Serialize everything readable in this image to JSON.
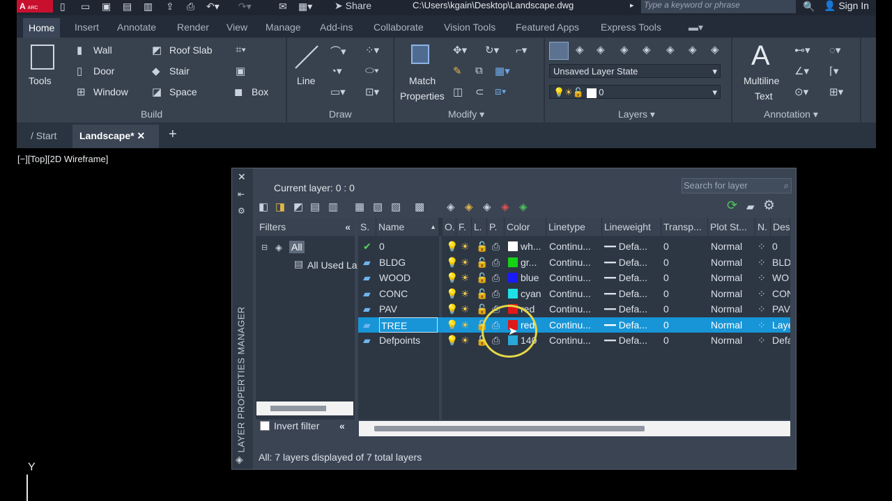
{
  "titlebar": {
    "logo": "A",
    "logo_sub": "ARC",
    "share": "Share",
    "path": "C:\\Users\\kgain\\Desktop\\Landscape.dwg",
    "search_placeholder": "Type a keyword or phrase",
    "signin": "Sign In"
  },
  "ribbon_tabs": [
    "Home",
    "Insert",
    "Annotate",
    "Render",
    "View",
    "Manage",
    "Add-ins",
    "Collaborate",
    "Vision Tools",
    "Featured Apps",
    "Express Tools"
  ],
  "build": {
    "tools": "Tools",
    "wall": "Wall",
    "roof_slab": "Roof Slab",
    "door": "Door",
    "stair": "Stair",
    "window": "Window",
    "space": "Space",
    "box": "Box",
    "title": "Build"
  },
  "draw": {
    "line": "Line",
    "title": "Draw"
  },
  "modify": {
    "match": "Match",
    "properties": "Properties",
    "title": "Modify"
  },
  "layers": {
    "state": "Unsaved Layer State",
    "current": "0",
    "title": "Layers"
  },
  "annotation": {
    "multiline": "Multiline",
    "text": "Text",
    "title": "Annotation",
    "big_a": "A"
  },
  "file_tabs": {
    "start": "Start",
    "active": "Landscape*",
    "close": "✕",
    "plus": "+"
  },
  "viewport_label": "[−][Top][2D Wireframe]",
  "dialog": {
    "side_title": "LAYER PROPERTIES MANAGER",
    "current_layer": "Current layer: 0 : 0",
    "search_placeholder": "Search for layer",
    "filters_title": "Filters",
    "filter_all": "All",
    "filter_used": "All Used La",
    "invert_filter": "Invert filter",
    "status": "All: 7 layers displayed of 7 total layers",
    "columns": [
      "S.",
      "Name",
      "O.",
      "F.",
      "L.",
      "P.",
      "Color",
      "Linetype",
      "Lineweight",
      "Transp...",
      "Plot St...",
      "N.",
      "Des"
    ],
    "rows": [
      {
        "name": "0",
        "color_name": "wh...",
        "swatch": "#ffffff",
        "linetype": "Continu...",
        "lineweight": "Defa...",
        "transp": "0",
        "plot": "Normal",
        "desc": "0",
        "current": true
      },
      {
        "name": "BLDG",
        "color_name": "gr...",
        "swatch": "#16d116",
        "linetype": "Continu...",
        "lineweight": "Defa...",
        "transp": "0",
        "plot": "Normal",
        "desc": "BLD"
      },
      {
        "name": "WOOD",
        "color_name": "blue",
        "swatch": "#1a1aff",
        "linetype": "Continu...",
        "lineweight": "Defa...",
        "transp": "0",
        "plot": "Normal",
        "desc": "WO"
      },
      {
        "name": "CONC",
        "color_name": "cyan",
        "swatch": "#1ee0e6",
        "linetype": "Continu...",
        "lineweight": "Defa...",
        "transp": "0",
        "plot": "Normal",
        "desc": "CON"
      },
      {
        "name": "PAV",
        "color_name": "red",
        "swatch": "#e01818",
        "linetype": "Continu...",
        "lineweight": "Defa...",
        "transp": "0",
        "plot": "Normal",
        "desc": "PAV"
      },
      {
        "name": "TREE",
        "color_name": "red",
        "swatch": "#e01818",
        "linetype": "Continu...",
        "lineweight": "Defa...",
        "transp": "0",
        "plot": "Normal",
        "desc": "Laye",
        "selected": true
      },
      {
        "name": "Defpoints",
        "color_name": "140",
        "swatch": "#2aa8d8",
        "linetype": "Continu...",
        "lineweight": "Defa...",
        "transp": "0",
        "plot": "Normal",
        "desc": "Defa"
      }
    ]
  },
  "ucs_label": "Y"
}
